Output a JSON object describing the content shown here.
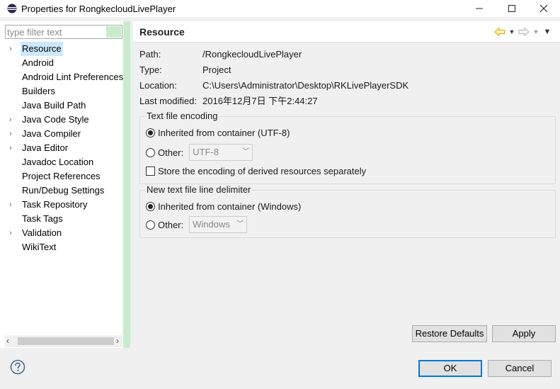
{
  "window": {
    "title": "Properties for RongkecloudLivePlayer",
    "minimize_icon": "minimize-icon",
    "maximize_icon": "maximize-icon",
    "close_icon": "close-icon"
  },
  "filter": {
    "placeholder": "type filter text"
  },
  "tree": {
    "items": [
      {
        "label": "Resource",
        "expandable": true,
        "selected": true
      },
      {
        "label": "Android",
        "expandable": false
      },
      {
        "label": "Android Lint Preferences",
        "expandable": false
      },
      {
        "label": "Builders",
        "expandable": false
      },
      {
        "label": "Java Build Path",
        "expandable": false
      },
      {
        "label": "Java Code Style",
        "expandable": true
      },
      {
        "label": "Java Compiler",
        "expandable": true
      },
      {
        "label": "Java Editor",
        "expandable": true
      },
      {
        "label": "Javadoc Location",
        "expandable": false
      },
      {
        "label": "Project References",
        "expandable": false
      },
      {
        "label": "Run/Debug Settings",
        "expandable": false
      },
      {
        "label": "Task Repository",
        "expandable": true
      },
      {
        "label": "Task Tags",
        "expandable": false
      },
      {
        "label": "Validation",
        "expandable": true
      },
      {
        "label": "WikiText",
        "expandable": false
      }
    ]
  },
  "page": {
    "title": "Resource",
    "info": {
      "path_label": "Path:",
      "path_value": "/RongkecloudLivePlayer",
      "type_label": "Type:",
      "type_value": "Project",
      "location_label": "Location:",
      "location_value": "C:\\Users\\Administrator\\Desktop\\RKLivePlayerSDK",
      "modified_label": "Last modified:",
      "modified_value": "2016年12月7日 下午2:44:27"
    },
    "encoding": {
      "legend": "Text file encoding",
      "inherited_label": "Inherited from container (UTF-8)",
      "other_label": "Other:",
      "other_value": "UTF-8",
      "derived_label": "Store the encoding of derived resources separately"
    },
    "delimiter": {
      "legend": "New text file line delimiter",
      "inherited_label": "Inherited from container (Windows)",
      "other_label": "Other:",
      "other_value": "Windows"
    },
    "restore_defaults": "Restore Defaults",
    "apply": "Apply"
  },
  "footer": {
    "ok": "OK",
    "cancel": "Cancel"
  },
  "colors": {
    "accent": "#0078d7",
    "filter_green": "#c8eccb",
    "selection": "#cce8ff"
  }
}
